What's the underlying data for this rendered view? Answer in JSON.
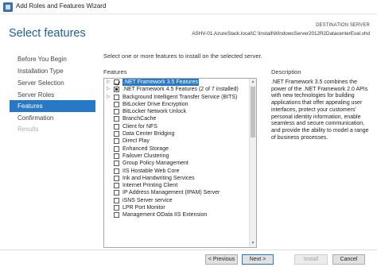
{
  "window": {
    "title": "Add Roles and Features Wizard"
  },
  "header": {
    "page_title": "Select features",
    "destination_label": "DESTINATION SERVER",
    "destination_value": "ASHV-01.AzureStack.local\\C:\\Install\\WindowsServer2012R2DatacenterEval.vhd"
  },
  "nav": {
    "items": [
      {
        "label": "Before You Begin",
        "state": "normal"
      },
      {
        "label": "Installation Type",
        "state": "normal"
      },
      {
        "label": "Server Selection",
        "state": "normal"
      },
      {
        "label": "Server Roles",
        "state": "normal"
      },
      {
        "label": "Features",
        "state": "active"
      },
      {
        "label": "Confirmation",
        "state": "normal"
      },
      {
        "label": "Results",
        "state": "disabled"
      }
    ]
  },
  "main": {
    "instruction": "Select one or more features to install on the selected server.",
    "features_label": "Features",
    "features": [
      {
        "label": ".NET Framework 3.5 Features",
        "check": "checked",
        "expandable": true,
        "selected": true
      },
      {
        "label": ".NET Framework 4.5 Features (2 of 7 installed)",
        "check": "partial",
        "expandable": true,
        "selected": false
      },
      {
        "label": "Background Intelligent Transfer Service (BITS)",
        "check": "none",
        "expandable": true,
        "selected": false
      },
      {
        "label": "BitLocker Drive Encryption",
        "check": "none",
        "expandable": false,
        "selected": false
      },
      {
        "label": "BitLocker Network Unlock",
        "check": "none",
        "expandable": false,
        "selected": false
      },
      {
        "label": "BranchCache",
        "check": "none",
        "expandable": false,
        "selected": false
      },
      {
        "label": "Client for NFS",
        "check": "none",
        "expandable": false,
        "selected": false
      },
      {
        "label": "Data Center Bridging",
        "check": "none",
        "expandable": false,
        "selected": false
      },
      {
        "label": "Direct Play",
        "check": "none",
        "expandable": false,
        "selected": false
      },
      {
        "label": "Enhanced Storage",
        "check": "none",
        "expandable": false,
        "selected": false
      },
      {
        "label": "Failover Clustering",
        "check": "none",
        "expandable": false,
        "selected": false
      },
      {
        "label": "Group Policy Management",
        "check": "none",
        "expandable": false,
        "selected": false
      },
      {
        "label": "IIS Hostable Web Core",
        "check": "none",
        "expandable": false,
        "selected": false
      },
      {
        "label": "Ink and Handwriting Services",
        "check": "none",
        "expandable": false,
        "selected": false
      },
      {
        "label": "Internet Printing Client",
        "check": "none",
        "expandable": false,
        "selected": false
      },
      {
        "label": "IP Address Management (IPAM) Server",
        "check": "none",
        "expandable": false,
        "selected": false
      },
      {
        "label": "iSNS Server service",
        "check": "none",
        "expandable": false,
        "selected": false
      },
      {
        "label": "LPR Port Monitor",
        "check": "none",
        "expandable": false,
        "selected": false
      },
      {
        "label": "Management OData IIS Extension",
        "check": "none",
        "expandable": false,
        "selected": false
      }
    ]
  },
  "description": {
    "title": "Description",
    "text": ".NET Framework 3.5 combines the power of the .NET Framework 2.0 APIs with new technologies for building applications that offer appealing user interfaces, protect your customers' personal identity information, enable seamless and secure communication, and provide the ability to model a range of business processes."
  },
  "footer": {
    "previous_label": "< Previous",
    "next_label": "Next >",
    "install_label": "Install",
    "cancel_label": "Cancel"
  },
  "colors": {
    "accent": "#2878c8",
    "title_blue": "#1f5f9c"
  }
}
